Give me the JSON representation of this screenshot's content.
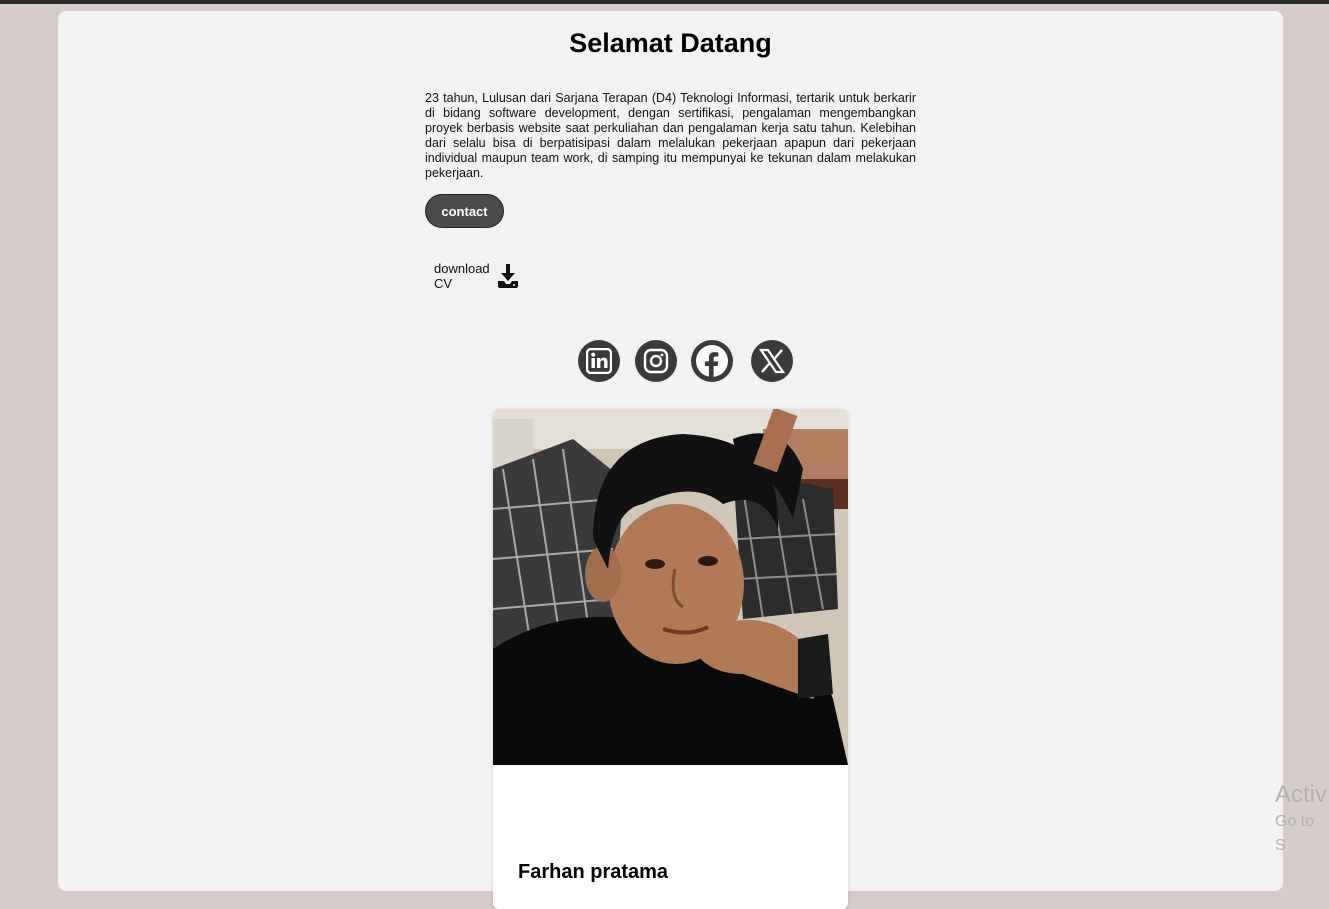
{
  "page": {
    "title": "Selamat Datang",
    "description": "23 tahun, Lulusan dari Sarjana Terapan (D4) Teknologi Informasi, tertarik untuk berkarir di bidang software development, dengan sertifikasi, pengalaman mengembangkan proyek berbasis website saat perkuliahan dan pengalaman kerja satu tahun. Kelebihan dari selalu bisa di berpatisipasi dalam melalukan pekerjaan apapun dari pekerjaan individual maupun team work, di samping itu mempunyai ke tekunan dalam melakukan pekerjaan.",
    "contact_label": "contact",
    "download": {
      "line1": "download",
      "line2": "CV",
      "icon": "download-icon"
    }
  },
  "socials": [
    {
      "name": "LinkedIn",
      "icon": "linkedin-icon"
    },
    {
      "name": "Instagram",
      "icon": "instagram-icon"
    },
    {
      "name": "Facebook",
      "icon": "facebook-icon"
    },
    {
      "name": "X",
      "icon": "x-icon"
    }
  ],
  "profile_card": {
    "name": "Farhan pratama",
    "photo": "profile-photo"
  },
  "watermark": {
    "line1": "Activ",
    "line2": "Go to S"
  },
  "colors": {
    "background": "#d6cccc",
    "panel": "#f2f2f2",
    "button": "#4a4a4a",
    "social_circle": "#3a3a3a"
  }
}
